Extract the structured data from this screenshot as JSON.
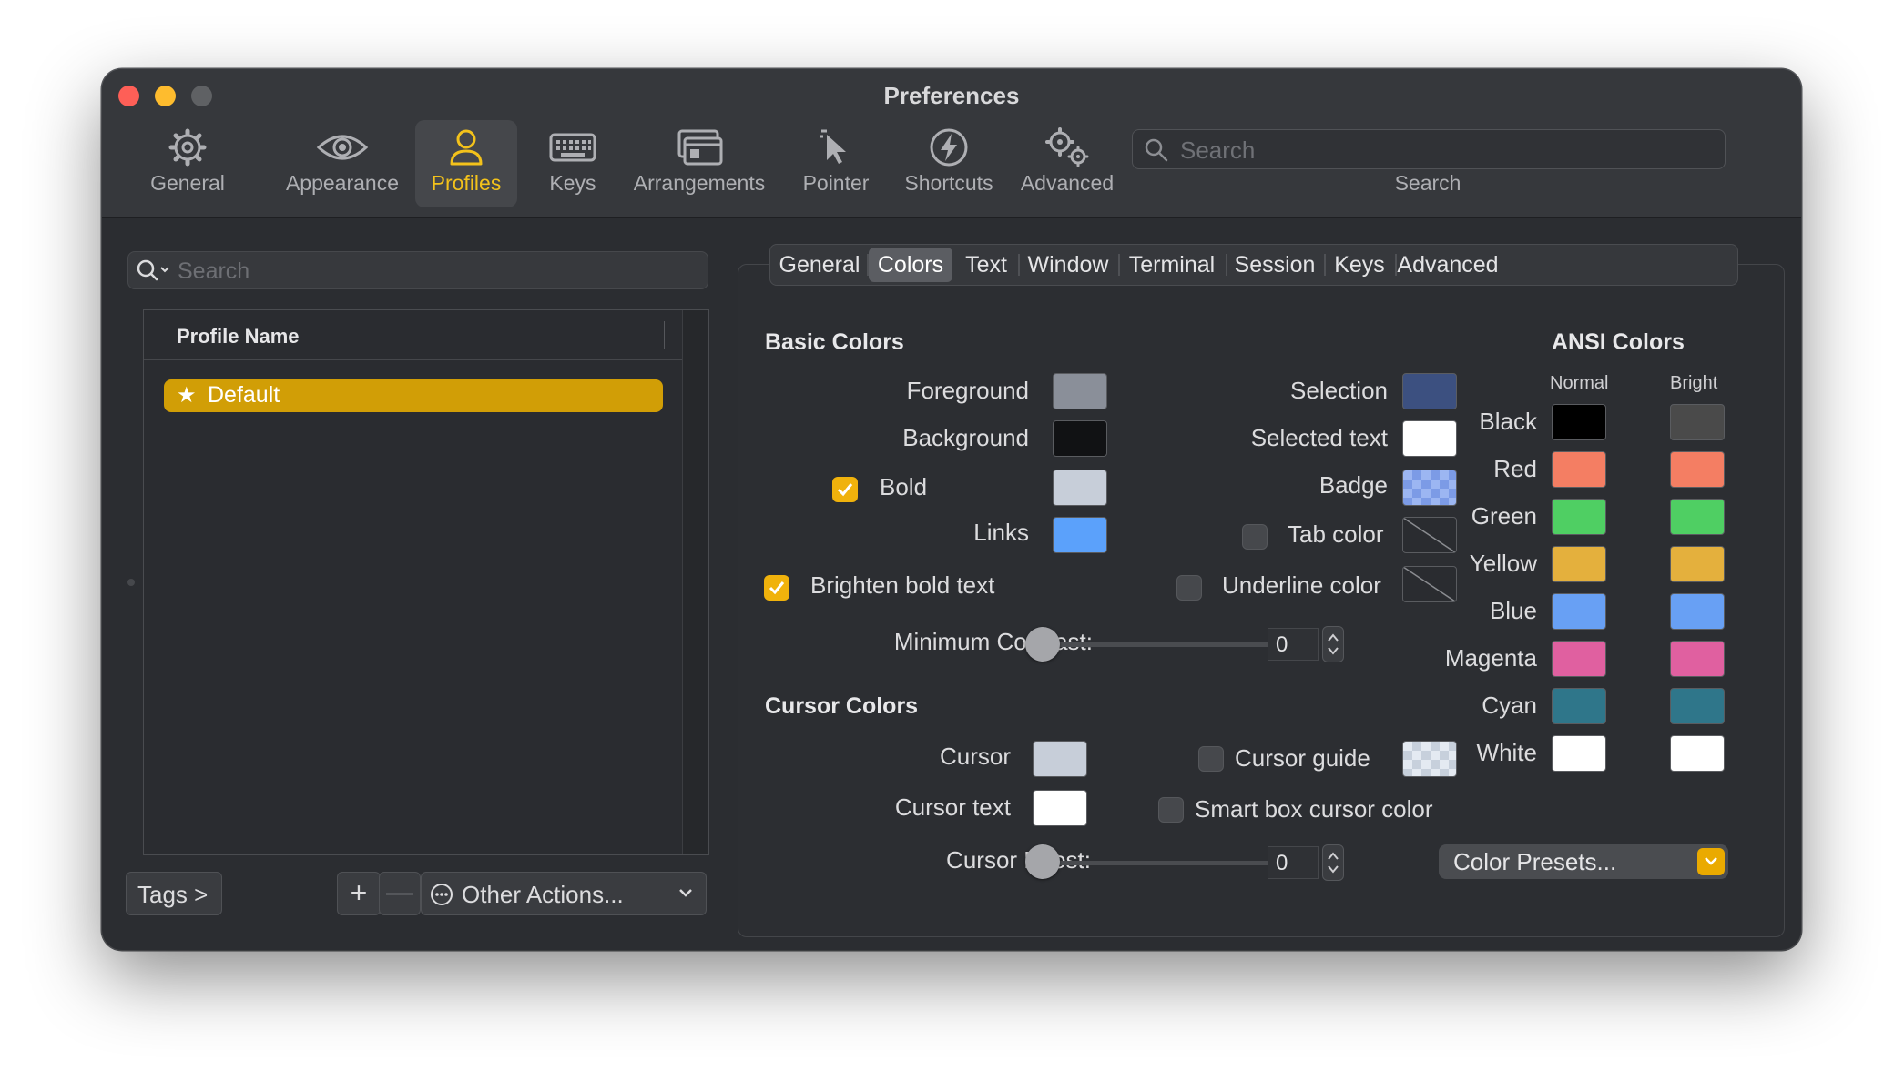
{
  "window": {
    "title": "Preferences"
  },
  "toolbar": {
    "items": [
      {
        "label": "General",
        "icon": "gear-icon"
      },
      {
        "label": "Appearance",
        "icon": "eye-icon"
      },
      {
        "label": "Profiles",
        "icon": "person-icon",
        "active": true
      },
      {
        "label": "Keys",
        "icon": "keyboard-icon"
      },
      {
        "label": "Arrangements",
        "icon": "windows-icon"
      },
      {
        "label": "Pointer",
        "icon": "cursor-icon"
      },
      {
        "label": "Shortcuts",
        "icon": "bolt-icon"
      },
      {
        "label": "Advanced",
        "icon": "gears-icon"
      }
    ],
    "search_placeholder": "Search",
    "search_caption": "Search"
  },
  "profiles": {
    "search_placeholder": "Search",
    "column_header": "Profile Name",
    "list": [
      {
        "name": "Default",
        "starred": true,
        "selected": true
      }
    ],
    "tags_button": "Tags >",
    "add_button": "+",
    "remove_button": "—",
    "other_actions": "Other Actions..."
  },
  "tabs": [
    {
      "label": "General"
    },
    {
      "label": "Colors",
      "active": true
    },
    {
      "label": "Text"
    },
    {
      "label": "Window"
    },
    {
      "label": "Terminal"
    },
    {
      "label": "Session"
    },
    {
      "label": "Keys"
    },
    {
      "label": "Advanced"
    }
  ],
  "basic_colors": {
    "title": "Basic Colors",
    "foreground": {
      "label": "Foreground",
      "color": "#8a8f99"
    },
    "background": {
      "label": "Background",
      "color": "#111214"
    },
    "bold": {
      "label": "Bold",
      "checked": true,
      "color": "#c7ced9"
    },
    "links": {
      "label": "Links",
      "color": "#5ba1fb"
    },
    "selection": {
      "label": "Selection",
      "color": "#3c5080"
    },
    "selected_text": {
      "label": "Selected text",
      "color": "#ffffff"
    },
    "badge": {
      "label": "Badge"
    },
    "tab_color": {
      "label": "Tab color",
      "checked": false
    },
    "brighten_bold": {
      "label": "Brighten bold text",
      "checked": true
    },
    "underline_color": {
      "label": "Underline color",
      "checked": false
    },
    "min_contrast": {
      "label": "Minimum Contrast:",
      "value": "0",
      "level": 0
    }
  },
  "cursor_colors": {
    "title": "Cursor Colors",
    "cursor": {
      "label": "Cursor",
      "color": "#c7ced9"
    },
    "cursor_text": {
      "label": "Cursor text",
      "color": "#ffffff"
    },
    "cursor_guide": {
      "label": "Cursor guide",
      "checked": false
    },
    "smart_box": {
      "label": "Smart box cursor color",
      "checked": false
    },
    "cursor_boost": {
      "label": "Cursor Boost:",
      "value": "0",
      "level": 0
    }
  },
  "ansi": {
    "title": "ANSI Colors",
    "normal_label": "Normal",
    "bright_label": "Bright",
    "rows": [
      {
        "name": "Black",
        "normal": "#000000",
        "bright": "#4a4a4a"
      },
      {
        "name": "Red",
        "normal": "#f47e63",
        "bright": "#f47e63"
      },
      {
        "name": "Green",
        "normal": "#4fcf63",
        "bright": "#4fcf63"
      },
      {
        "name": "Yellow",
        "normal": "#e4b03d",
        "bright": "#e4b03d"
      },
      {
        "name": "Blue",
        "normal": "#68a0f4",
        "bright": "#68a0f4"
      },
      {
        "name": "Magenta",
        "normal": "#e060a0",
        "bright": "#e060a0"
      },
      {
        "name": "Cyan",
        "normal": "#2f768a",
        "bright": "#2f768a"
      },
      {
        "name": "White",
        "normal": "#ffffff",
        "bright": "#ffffff"
      }
    ],
    "presets_button": "Color Presets..."
  }
}
